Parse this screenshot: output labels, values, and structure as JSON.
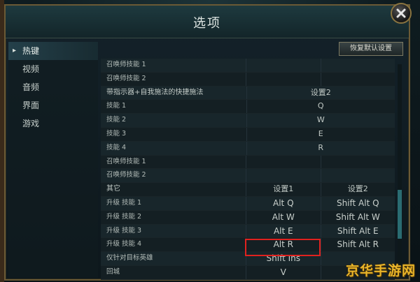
{
  "window": {
    "title": "选项"
  },
  "sidebar": {
    "items": [
      {
        "label": "热键",
        "active": true
      },
      {
        "label": "视频",
        "active": false
      },
      {
        "label": "音频",
        "active": false
      },
      {
        "label": "界面",
        "active": false
      },
      {
        "label": "游戏",
        "active": false
      }
    ]
  },
  "toolbar": {
    "reset_label": "恢复默认设置"
  },
  "table": {
    "rows": [
      {
        "name": "召唤师技能 1",
        "k1": "",
        "k2": ""
      },
      {
        "name": "召唤师技能 2",
        "k1": "",
        "k2": ""
      },
      {
        "name": "带指示器+自我施法的快捷施法",
        "span": "设置2",
        "header": true
      },
      {
        "name": "技能 1",
        "span": "Q"
      },
      {
        "name": "技能 2",
        "span": "W"
      },
      {
        "name": "技能 3",
        "span": "E"
      },
      {
        "name": "技能 4",
        "span": "R"
      },
      {
        "name": "召唤师技能 1",
        "k1": "",
        "k2": ""
      },
      {
        "name": "召唤师技能 2",
        "k1": "",
        "k2": ""
      },
      {
        "name": "其它",
        "k1": "设置1",
        "k2": "设置2",
        "header": true
      },
      {
        "name": "升级 技能 1",
        "k1": "Alt  Q",
        "k2": "Shift  Alt  Q"
      },
      {
        "name": "升级 技能 2",
        "k1": "Alt  W",
        "k2": "Shift  Alt  W"
      },
      {
        "name": "升级 技能 3",
        "k1": "Alt  E",
        "k2": "Shift  Alt  E"
      },
      {
        "name": "升级 技能 4",
        "k1": "Alt  R",
        "k2": "Shift  Alt  R"
      },
      {
        "name": "仅针对目标英雄",
        "k1": "Shift  Ins",
        "k2": ""
      },
      {
        "name": "回城",
        "k1": "V",
        "k2": ""
      }
    ]
  },
  "watermark": {
    "text": "京华手游网"
  },
  "colors": {
    "accent": "#2a6c72",
    "highlight": "#e0221f",
    "gold_border": "#6b5a35"
  }
}
